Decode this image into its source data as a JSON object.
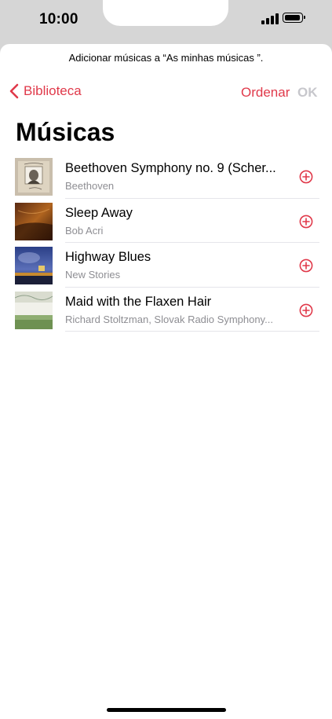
{
  "status": {
    "time": "10:00",
    "signal_icon": "cellular-signal-icon",
    "battery_icon": "battery-full-icon"
  },
  "sheet": {
    "prompt": "Adicionar músicas a “As minhas músicas ”.",
    "back_label": "Biblioteca",
    "sort_label": "Ordenar",
    "ok_label": "OK",
    "title": "Músicas"
  },
  "songs": [
    {
      "title": "Beethoven Symphony no. 9 (Scher...",
      "artist": "Beethoven",
      "art_icon": "beethoven-portrait-artwork"
    },
    {
      "title": "Sleep Away",
      "artist": "Bob Acri",
      "art_icon": "piano-artwork"
    },
    {
      "title": "Highway Blues",
      "artist": "New Stories",
      "art_icon": "blue-sky-artwork"
    },
    {
      "title": "Maid with the Flaxen Hair",
      "artist": "Richard Stoltzman, Slovak Radio Symphony...",
      "art_icon": "richard-stoltzman-album-artwork",
      "art_text": "RICHARD STOLTZMAN"
    }
  ],
  "colors": {
    "accent": "#e0394a",
    "disabled": "#c7c7cc",
    "secondary_text": "#8e8e93"
  }
}
